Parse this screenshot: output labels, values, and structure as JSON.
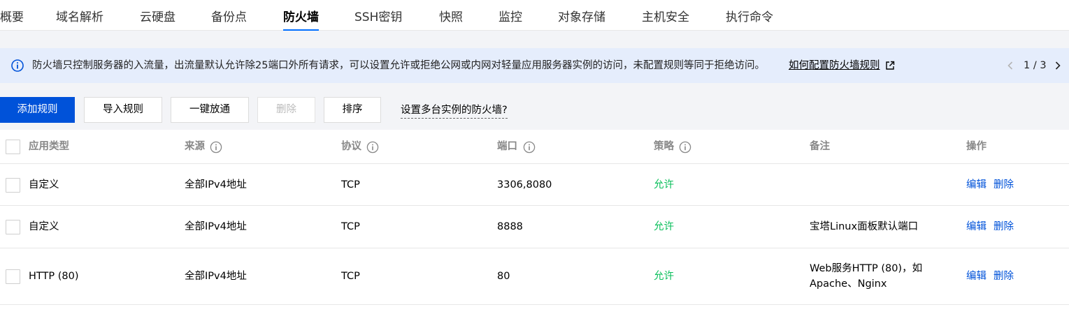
{
  "tabs": [
    {
      "label": "概要"
    },
    {
      "label": "域名解析"
    },
    {
      "label": "云硬盘"
    },
    {
      "label": "备份点"
    },
    {
      "label": "防火墙",
      "active": true
    },
    {
      "label": "SSH密钥"
    },
    {
      "label": "快照"
    },
    {
      "label": "监控"
    },
    {
      "label": "对象存储"
    },
    {
      "label": "主机安全"
    },
    {
      "label": "执行命令"
    }
  ],
  "notice": {
    "icon": "info-circle-icon",
    "text": "防火墙只控制服务器的入流量，出流量默认允许除25端口外所有请求，可以设置允许或拒绝公网或内网对轻量应用服务器实例的访问，未配置规则等同于拒绝访问。",
    "link_label": "如何配置防火墙规则",
    "pager": "1 / 3"
  },
  "toolbar": {
    "add_label": "添加规则",
    "import_label": "导入规则",
    "open_all_label": "一键放通",
    "delete_label": "删除",
    "sort_label": "排序",
    "multi_instance_label": "设置多台实例的防火墙?"
  },
  "table": {
    "headers": {
      "type": "应用类型",
      "source": "来源",
      "protocol": "协议",
      "port": "端口",
      "policy": "策略",
      "remark": "备注",
      "actions": "操作"
    },
    "rows": [
      {
        "type": "自定义",
        "source": "全部IPv4地址",
        "protocol": "TCP",
        "port": "3306,8080",
        "policy": "允许",
        "remark": "",
        "edit": "编辑",
        "delete": "删除"
      },
      {
        "type": "自定义",
        "source": "全部IPv4地址",
        "protocol": "TCP",
        "port": "8888",
        "policy": "允许",
        "remark": "宝塔Linux面板默认端口",
        "edit": "编辑",
        "delete": "删除"
      },
      {
        "type": "HTTP (80)",
        "source": "全部IPv4地址",
        "protocol": "TCP",
        "port": "80",
        "policy": "允许",
        "remark_line1": "Web服务HTTP (80)，如",
        "remark_line2": "Apache、Nginx",
        "edit": "编辑",
        "delete": "删除"
      }
    ]
  },
  "colors": {
    "primary": "#0052d9",
    "allow": "#0abf5b",
    "notice_bg": "#e5edfc",
    "tab_underline": "#006eff"
  }
}
